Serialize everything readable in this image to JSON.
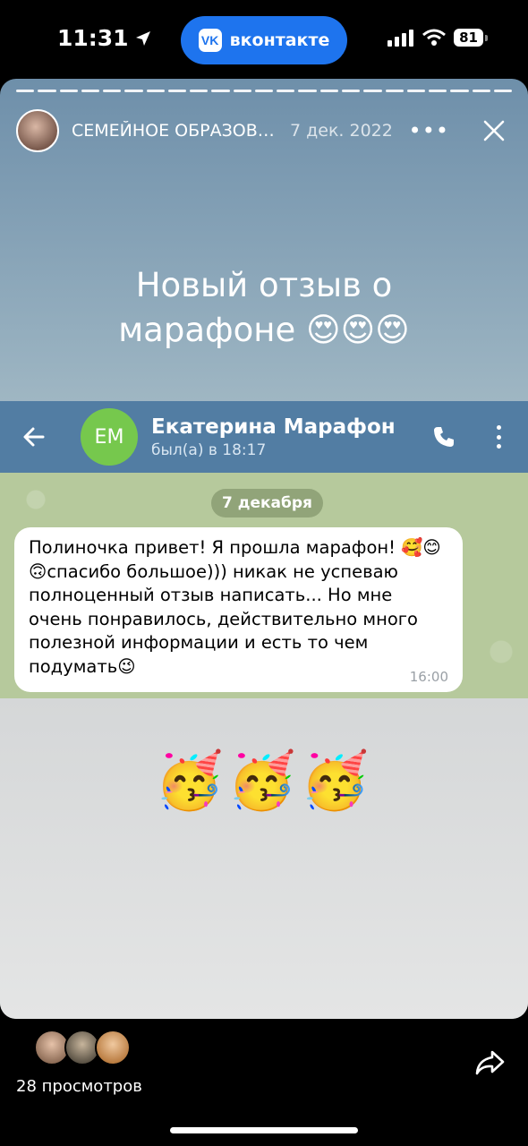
{
  "status_bar": {
    "time": "11:31",
    "battery": "81"
  },
  "app_pill": {
    "label": "вконтакте",
    "logo_text": "VK"
  },
  "story": {
    "author": "СЕМЕЙНОЕ ОБРАЗОВАНИЕ",
    "date": "7 дек. 2022",
    "text_line1": "Новый отзыв о",
    "text_line2": "марафоне 😍😍😍",
    "more_icon": "•••"
  },
  "telegram": {
    "avatar_initials": "ЕМ",
    "contact_name": "Екатерина Марафон",
    "contact_status": "был(а) в 18:17",
    "date_chip": "7 декабря",
    "message": {
      "text": "Полиночка привет! Я прошла марафон! 🥰😊🙃спасибо большое))) никак не успеваю полноценный отзыв написать... Но мне очень понравилось, действительно много полезной информации и есть то чем подумать😉",
      "time": "16:00"
    },
    "party_emojis": "🥳🥳🥳"
  },
  "footer": {
    "views": "28 просмотров"
  },
  "colors": {
    "vk_blue": "#1e74ee",
    "tg_header": "#527da3",
    "avatar_green": "#76c84d"
  }
}
